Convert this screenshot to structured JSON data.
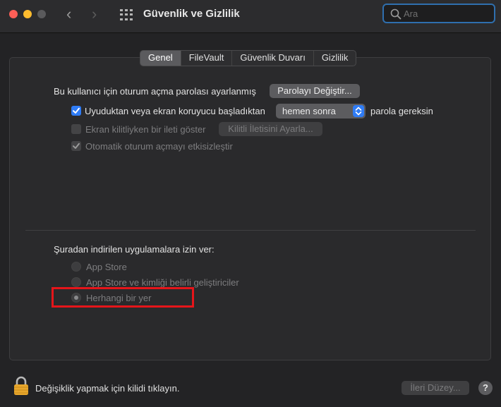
{
  "window": {
    "title": "Güvenlik ve Gizlilik",
    "search_placeholder": "Ara"
  },
  "tabs": [
    {
      "label": "Genel",
      "active": true
    },
    {
      "label": "FileVault",
      "active": false
    },
    {
      "label": "Güvenlik Duvarı",
      "active": false
    },
    {
      "label": "Gizlilik",
      "active": false
    }
  ],
  "general": {
    "password_text": "Bu kullanıcı için oturum açma parolası ayarlanmış",
    "change_password_button": "Parolayı Değiştir...",
    "require_password": {
      "label": "Uyuduktan veya ekran koruyucu başladıktan",
      "checked": true,
      "popup_value": "hemen sonra",
      "suffix": "parola gereksin"
    },
    "lock_message": {
      "label": "Ekran kilitliyken bir ileti göster",
      "checked": false,
      "button": "Kilitli İletisini Ayarla..."
    },
    "auto_login": {
      "label": "Otomatik oturum açmayı etkisizleştir",
      "checked": true
    }
  },
  "downloads": {
    "heading": "Şuradan indirilen uygulamalara izin ver:",
    "options": [
      {
        "label": "App Store",
        "selected": false
      },
      {
        "label": "App Store ve kimliği belirli geliştiriciler",
        "selected": false
      },
      {
        "label": "Herhangi bir yer",
        "selected": true
      }
    ]
  },
  "footer": {
    "lock_text": "Değişiklik yapmak için kilidi tıklayın.",
    "advanced_button": "İleri Düzey...",
    "help_label": "?"
  },
  "colors": {
    "accent": "#2f7cf6",
    "highlight": "#e5151a",
    "close": "#fe5f57",
    "minimize": "#febc2e"
  }
}
